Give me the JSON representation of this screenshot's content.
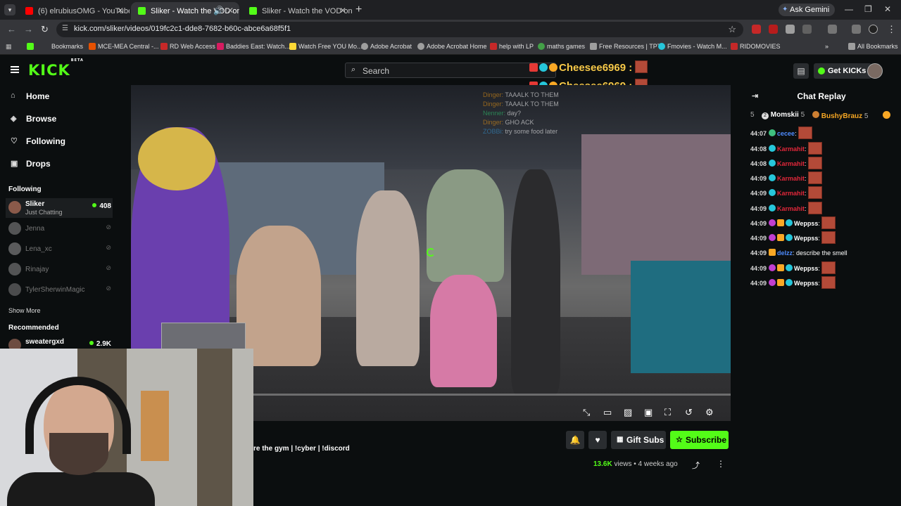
{
  "browser": {
    "tabs": [
      {
        "label": "(6) elrubiusOMG - YouTube",
        "active": false
      },
      {
        "label": "Sliker - Watch the VOD on",
        "active": true
      },
      {
        "label": "Sliker - Watch the VOD on Kick",
        "active": false
      }
    ],
    "ask_gemini": "Ask Gemini",
    "url": "kick.com/sliker/videos/019fc2c1-dde8-7682-b60c-abce6a68f5f1",
    "bookmarks": [
      "Bookmarks",
      "MCE-MEA Central -...",
      "RD Web Access",
      "Baddies East: Watch...",
      "Watch Free YOU Mo...",
      "Adobe Acrobat",
      "Adobe Acrobat Home",
      "help with LP",
      "maths games",
      "Free Resources | TPT",
      "Fmovies - Watch M...",
      "RIDOMOVIES"
    ],
    "all_bookmarks": "All Bookmarks"
  },
  "header": {
    "logo": "KICK",
    "beta": "BETA",
    "search_placeholder": "Search",
    "get_kicks": "Get KICKs",
    "overlay_names": [
      "Cheesee6969 :",
      "Cheesee6969 :"
    ]
  },
  "sidebar": {
    "nav": [
      "Home",
      "Browse",
      "Following",
      "Drops"
    ],
    "following_title": "Following",
    "following": [
      {
        "name": "Sliker",
        "sub": "Just Chatting",
        "viewers": "408",
        "live": true
      },
      {
        "name": "Jenna",
        "live": false
      },
      {
        "name": "Lena_xc",
        "live": false
      },
      {
        "name": "Rinajay",
        "live": false
      },
      {
        "name": "TylerSherwinMagic",
        "live": false
      }
    ],
    "show_more": "Show More",
    "recommended_title": "Recommended",
    "recommended": [
      {
        "name": "sweatergxd",
        "viewers": "2.9K"
      }
    ]
  },
  "video": {
    "overlay_chat": [
      {
        "name": "Dinger:",
        "text": "TAAALK TO THEM"
      },
      {
        "name": "Dinger:",
        "text": "TAAALK TO THEM"
      },
      {
        "name": "Nenner:",
        "text": "day?"
      },
      {
        "name": "Dinger:",
        "text": "GHO ACK"
      },
      {
        "name": "ZOBBi:",
        "text": "try some food later"
      }
    ]
  },
  "below": {
    "title": "re the gym | !cyber | !discord",
    "gift_subs": "Gift Subs",
    "subscribe": "Subscribe",
    "views": "13.6K",
    "views_label": "views",
    "age": "4 weeks ago"
  },
  "chat": {
    "title": "Chat Replay",
    "gifters": [
      {
        "rank": "2",
        "name": "Momskii",
        "count": "5"
      },
      {
        "rank": "",
        "name": "BushyBrauz",
        "count": "5"
      }
    ],
    "messages": [
      {
        "time": "44:07",
        "user": "cecee",
        "text": ":",
        "color": "#4e8cff",
        "emote": true
      },
      {
        "time": "44:08",
        "user": "Karmahit",
        "text": ":",
        "color": "#e0273a",
        "emote": true
      },
      {
        "time": "44:08",
        "user": "Karmahit",
        "text": ":",
        "color": "#e0273a",
        "emote": true
      },
      {
        "time": "44:09",
        "user": "Karmahit",
        "text": ":",
        "color": "#e0273a",
        "emote": true
      },
      {
        "time": "44:09",
        "user": "Karmahit",
        "text": ":",
        "color": "#e0273a",
        "emote": true
      },
      {
        "time": "44:09",
        "user": "Karmahit",
        "text": ":",
        "color": "#e0273a",
        "emote": true
      },
      {
        "time": "44:09",
        "user": "Weppss",
        "text": ":",
        "color": "#ffffff",
        "emote": true
      },
      {
        "time": "44:09",
        "user": "Weppss",
        "text": ":",
        "color": "#ffffff",
        "emote": true
      },
      {
        "time": "44:09",
        "user": "delzz",
        "text": ": describe the smell",
        "color": "#4e8cff",
        "emote": false
      },
      {
        "time": "44:09",
        "user": "Weppss",
        "text": ":",
        "color": "#ffffff",
        "emote": true
      },
      {
        "time": "44:09",
        "user": "Weppss",
        "text": ":",
        "color": "#ffffff",
        "emote": true
      }
    ]
  },
  "colors": {
    "brand": "#53fc18",
    "overlay_name": "#f7c948"
  }
}
